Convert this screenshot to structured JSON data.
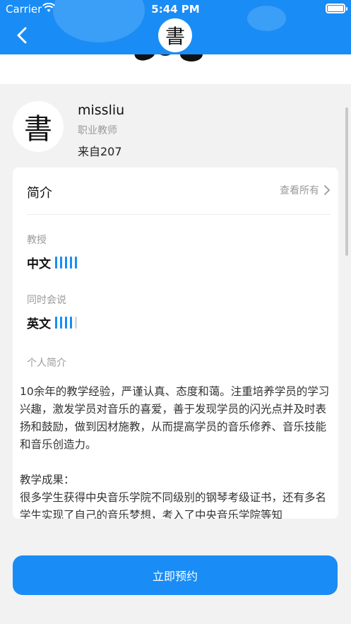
{
  "status_bar": {
    "carrier": "Carrier",
    "time": "5:44 PM"
  },
  "nav": {
    "logo_glyph": "書"
  },
  "profile": {
    "avatar_glyph": "書",
    "name": "missliu",
    "role": "职业教师",
    "origin": "来自207"
  },
  "intro": {
    "title": "简介",
    "see_all": "查看所有",
    "teaches_label": "教授",
    "teaches": {
      "language": "中文",
      "level": 5,
      "max": 5
    },
    "also_speaks_label": "同时会说",
    "speaks": {
      "language": "英文",
      "level": 4,
      "max": 5
    },
    "personal_intro_label": "个人简介",
    "bio": "10余年的教学经验，严谨认真、态度和蔼。注重培养学员的学习兴趣，激发学员对音乐的喜爱，善于发现学员的闪光点并及时表扬和鼓励，做到因材施教，从而提高学员的音乐修养、音乐技能和音乐创造力。\n\n教学成果：\n很多学生获得中央音乐学院不同级别的钢琴考级证书，还有多名学生实现了自己的音乐梦想，考入了中央音乐学院等知"
  },
  "book_button": {
    "label": "立即预约"
  },
  "colors": {
    "accent": "#1a8cf5",
    "bar_off": "#d9d9d9"
  }
}
